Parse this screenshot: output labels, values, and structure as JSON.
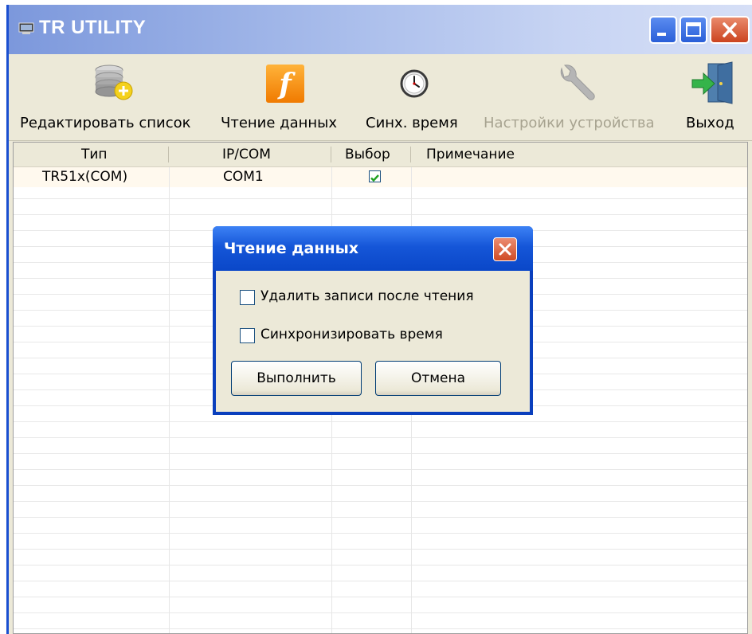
{
  "window": {
    "title": "TR UTILITY"
  },
  "toolbar": {
    "edit_list": "Редактировать список",
    "read_data": "Чтение данных",
    "sync_time": "Синх. время",
    "device_settings": "Настройки устройства",
    "exit": "Выход"
  },
  "table": {
    "columns": [
      "Тип",
      "IP/COM",
      "Выбор",
      "Примечание"
    ],
    "rows": [
      {
        "type": "TR51x(COM)",
        "ip_com": "COM1",
        "selected": true,
        "note": ""
      }
    ]
  },
  "dialog": {
    "title": "Чтение данных",
    "delete_after_read": {
      "label": "Удалить записи после чтения",
      "checked": false
    },
    "sync_time": {
      "label": "Синхронизировать время",
      "checked": false
    },
    "ok_button": "Выполнить",
    "cancel_button": "Отмена"
  },
  "colors": {
    "titlebar_start": "#7c98dc",
    "dialog_title": "#1556d8",
    "window_face": "#ECE9D8",
    "close_red": "#d04b25"
  }
}
